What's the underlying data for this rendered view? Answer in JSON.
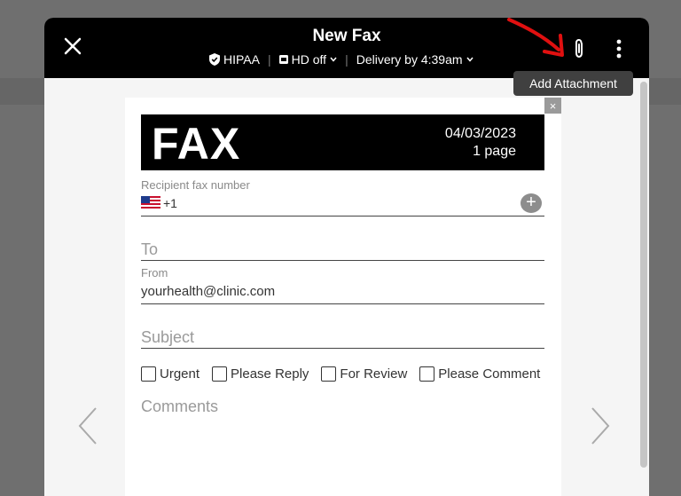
{
  "header": {
    "title": "New Fax",
    "hipaa_label": "HIPAA",
    "hd_label": "HD off",
    "delivery_label": "Delivery by 4:39am"
  },
  "tooltip": {
    "text": "Add Attachment"
  },
  "cover": {
    "fax_title": "FAX",
    "date": "04/03/2023",
    "pages": "1 page",
    "close_glyph": "×"
  },
  "form": {
    "recipient_label": "Recipient fax number",
    "phone_prefix": "+1",
    "to_placeholder": "To",
    "from_label": "From",
    "from_value": "yourhealth@clinic.com",
    "subject_placeholder": "Subject",
    "comments_placeholder": "Comments",
    "checkboxes": [
      "Urgent",
      "Please Reply",
      "For Review",
      "Please Comment"
    ]
  },
  "colors": {
    "header_bg": "#000000",
    "arrow": "#e01010",
    "tooltip_bg": "#404040"
  },
  "icons": [
    "close-icon",
    "shield-icon",
    "hd-icon",
    "chevron-down-icon",
    "paperclip-icon",
    "more-vertical-icon",
    "chevron-left-icon",
    "chevron-right-icon",
    "us-flag-icon",
    "plus-icon"
  ]
}
